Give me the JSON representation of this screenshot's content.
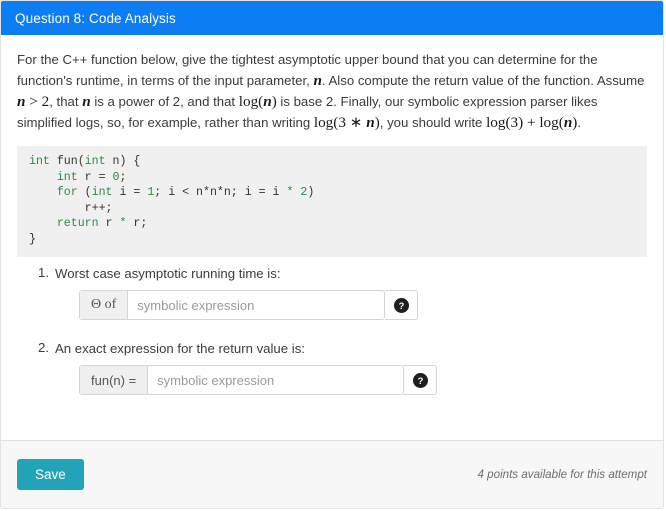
{
  "header": {
    "title": "Question 8: Code Analysis",
    "background_color": "#0d7df4",
    "text_color": "#ffffff"
  },
  "prompt": {
    "seg1": "For the C++ function below, give the tightest asymptotic upper bound that you can determine for the function's runtime, in terms of the input parameter, ",
    "math_n1": "n",
    "seg2": ". Also compute the return value of the function. Assume ",
    "math_ngt2": "n > 2",
    "seg3": ", that ",
    "math_n2": "n",
    "seg4": " is a power of 2, and that ",
    "math_logn": "log(n)",
    "seg5": " is base 2. Finally, our symbolic expression parser likes simplified logs, so, for example, rather than writing ",
    "math_log3n": "log(3 * n)",
    "seg6": ", you should write ",
    "math_log3pluslogn": "log(3) + log(n)",
    "seg7": "."
  },
  "code": {
    "language": "cpp",
    "lines": [
      [
        {
          "t": "int",
          "c": "kw"
        },
        {
          "t": " fun(",
          "c": "pl"
        },
        {
          "t": "int",
          "c": "kw"
        },
        {
          "t": " n) {",
          "c": "pl"
        }
      ],
      [
        {
          "t": "    ",
          "c": "pl"
        },
        {
          "t": "int",
          "c": "kw"
        },
        {
          "t": " r = ",
          "c": "pl"
        },
        {
          "t": "0",
          "c": "num"
        },
        {
          "t": ";",
          "c": "pl"
        }
      ],
      [
        {
          "t": "    ",
          "c": "pl"
        },
        {
          "t": "for",
          "c": "kw"
        },
        {
          "t": " (",
          "c": "pl"
        },
        {
          "t": "int",
          "c": "kw"
        },
        {
          "t": " i = ",
          "c": "pl"
        },
        {
          "t": "1",
          "c": "num"
        },
        {
          "t": "; i < n*n*n; i = i ",
          "c": "pl"
        },
        {
          "t": "*",
          "c": "num"
        },
        {
          "t": " ",
          "c": "pl"
        },
        {
          "t": "2",
          "c": "num"
        },
        {
          "t": ")",
          "c": "pl"
        }
      ],
      [
        {
          "t": "        r++;",
          "c": "pl"
        }
      ],
      [
        {
          "t": "    ",
          "c": "pl"
        },
        {
          "t": "return",
          "c": "kw"
        },
        {
          "t": " r ",
          "c": "pl"
        },
        {
          "t": "*",
          "c": "num"
        },
        {
          "t": " r;",
          "c": "pl"
        }
      ],
      [
        {
          "t": "}",
          "c": "pl"
        }
      ]
    ]
  },
  "answers": [
    {
      "label": "Worst case asymptotic running time is:",
      "prefix": "Θ of",
      "prefix_style": "theta",
      "value": "",
      "placeholder": "symbolic expression",
      "help_icon": "question-mark-circle-icon"
    },
    {
      "label": "An exact expression for the return value is:",
      "prefix": "fun(n) =",
      "prefix_style": "plain",
      "value": "",
      "placeholder": "symbolic expression",
      "help_icon": "question-mark-circle-icon"
    }
  ],
  "footer": {
    "save_label": "Save",
    "save_color": "#23a3b8",
    "points_note": "4 points available for this attempt"
  }
}
